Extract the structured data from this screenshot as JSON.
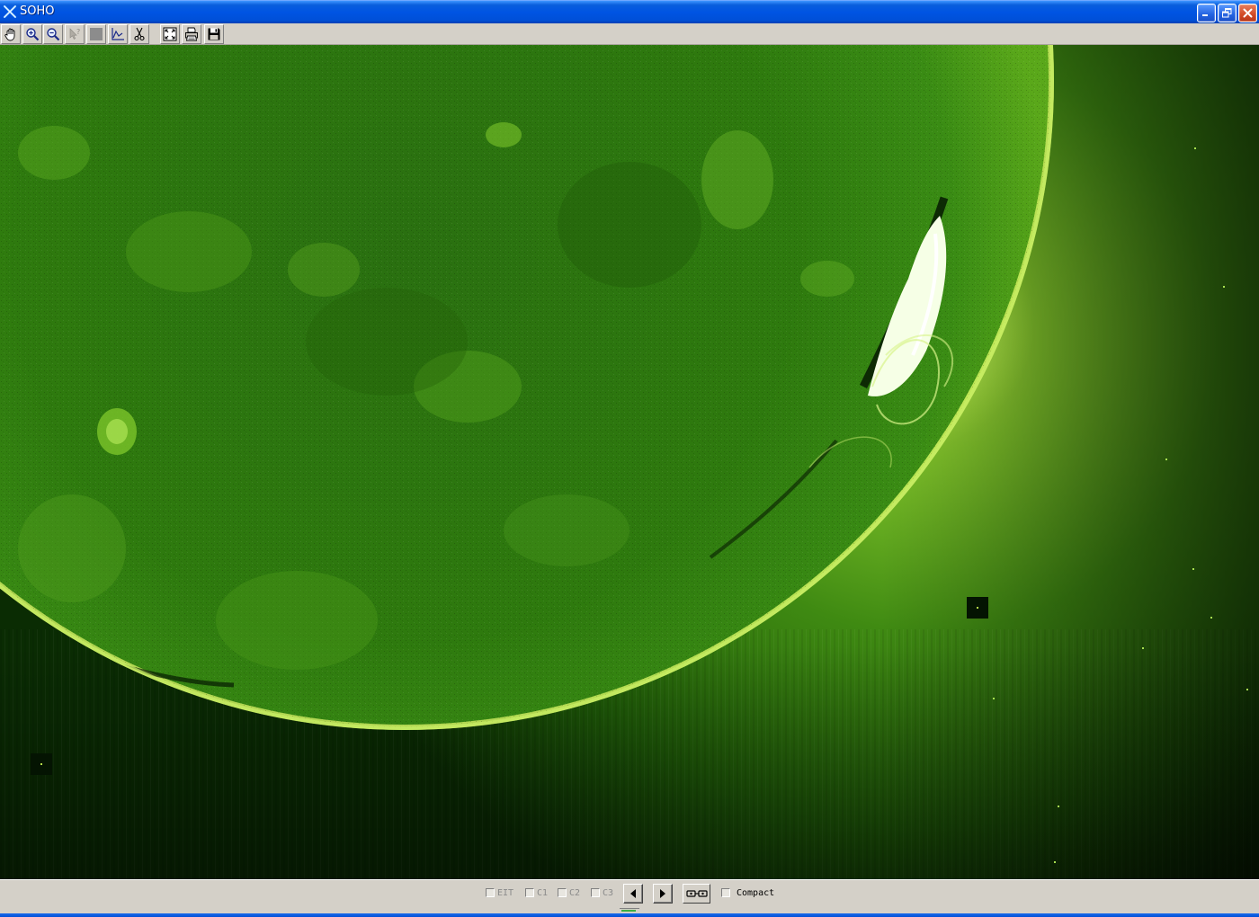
{
  "window": {
    "title": "SOHO",
    "minimize_label": "",
    "maximize_label": "",
    "close_label": ""
  },
  "toolbar": {
    "tools": [
      {
        "name": "pan-tool",
        "icon": "hand-icon",
        "enabled": true
      },
      {
        "name": "zoom-in-tool",
        "icon": "zoom-in-icon",
        "enabled": true
      },
      {
        "name": "zoom-out-tool",
        "icon": "zoom-out-icon",
        "enabled": true
      },
      {
        "name": "help-tool",
        "icon": "pointer-help-icon",
        "enabled": false
      },
      {
        "name": "blank-tool",
        "icon": "blank-icon",
        "enabled": false
      },
      {
        "name": "graph-tool",
        "icon": "graph-icon",
        "enabled": true
      },
      {
        "name": "cut-tool",
        "icon": "scissors-icon",
        "enabled": true
      },
      {
        "name": "fit-tool",
        "icon": "fit-window-icon",
        "enabled": true
      },
      {
        "name": "print-tool",
        "icon": "printer-icon",
        "enabled": true
      },
      {
        "name": "save-tool",
        "icon": "floppy-disk-icon",
        "enabled": true
      }
    ]
  },
  "viewer": {
    "image_description_icon": "solar-image",
    "colors": {
      "disk": "#2e7a0e",
      "corona": "#5aa81a",
      "limb": "#b5e04a",
      "flare": "#f4ffe0",
      "background": "#0b3304"
    }
  },
  "bottombar": {
    "checkboxes": [
      {
        "label": "EIT",
        "checked": false,
        "enabled": false
      },
      {
        "label": "C1",
        "checked": false,
        "enabled": false
      },
      {
        "label": "C2",
        "checked": false,
        "enabled": false
      },
      {
        "label": "C3",
        "checked": false,
        "enabled": false
      }
    ],
    "prev_icon": "triangle-left-icon",
    "next_icon": "triangle-right-icon",
    "animate_icon": "film-loop-icon",
    "compact": {
      "label": "Compact",
      "checked": false
    },
    "progress_fraction": 0.05
  }
}
